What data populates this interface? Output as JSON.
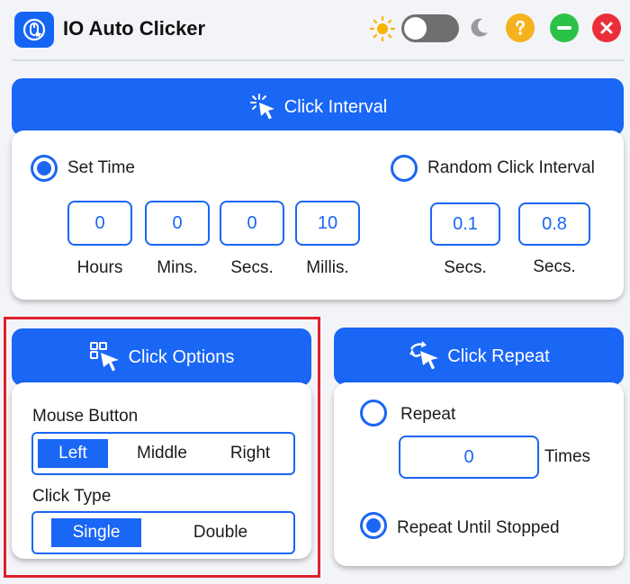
{
  "app": {
    "title": "IO Auto Clicker"
  },
  "colors": {
    "accent": "#1a66f5",
    "help": "#f5b21e",
    "minimize": "#2cc24a",
    "close": "#ea2f3b",
    "highlight": "#e0202c"
  },
  "theme_toggle": {
    "sun_icon": "sun-icon",
    "moon_icon": "moon-icon",
    "state": "light"
  },
  "click_interval": {
    "title": "Click Interval",
    "set_time_label": "Set Time",
    "random_label": "Random Click Interval",
    "hours": {
      "value": "0",
      "label": "Hours"
    },
    "mins": {
      "value": "0",
      "label": "Mins."
    },
    "secs": {
      "value": "0",
      "label": "Secs."
    },
    "millis": {
      "value": "10",
      "label": "Millis."
    },
    "random_min": {
      "value": "0.1",
      "label": "Secs."
    },
    "random_max": {
      "value": "0.8",
      "label": "Secs."
    },
    "selected": "set_time"
  },
  "click_options": {
    "title": "Click Options",
    "mouse_button_label": "Mouse Button",
    "mouse_buttons": [
      "Left",
      "Middle",
      "Right"
    ],
    "mouse_button_selected": "Left",
    "click_type_label": "Click Type",
    "click_types": [
      "Single",
      "Double"
    ],
    "click_type_selected": "Single"
  },
  "click_repeat": {
    "title": "Click Repeat",
    "repeat_label": "Repeat",
    "repeat_value": "0",
    "times_label": "Times",
    "until_stopped_label": "Repeat Until Stopped",
    "selected": "until_stopped"
  }
}
